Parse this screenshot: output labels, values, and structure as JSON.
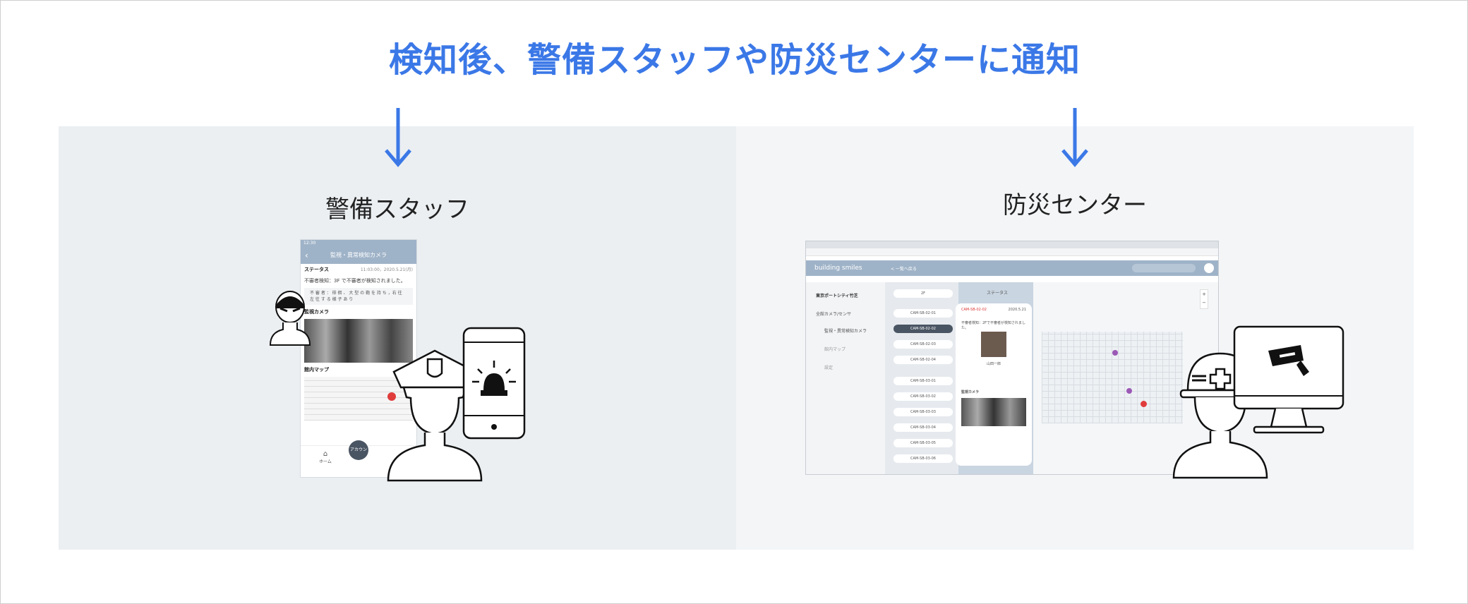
{
  "title": "検知後、警備スタッフや防災センターに通知",
  "colors": {
    "accent": "#3b78e7",
    "left_panel": "#ebeff2",
    "right_panel": "#f3f5f7",
    "app_header": "#9fb3c8"
  },
  "left": {
    "heading": "警備スタッフ",
    "phone": {
      "status_time": "12:30",
      "app_title": "監視・異常検知カメラ",
      "status_label": "ステータス",
      "status_time_detail": "11:03:00，2020.5.21(月)",
      "alert_text": "不審者検知：3F で不審者が検知されました。",
      "note_text": "不 審 者 ： 徘 徊 、 大 型 の 鞄 を 持 ち ，右 往 左 往 す る 様 子 あ り",
      "camera_label": "監視カメラ",
      "map_label": "館内マップ",
      "tab_home": "ホーム",
      "tab_center": "アカウント"
    }
  },
  "right": {
    "heading": "防災センター",
    "browser": {
      "brand": "building smiles",
      "nav_link": "< 一覧へ戻る",
      "sidebar": [
        "東京ポートシティ竹芝",
        "全館カメラ/センサ",
        "監視・異常検知カメラ",
        "館内マップ",
        "設定"
      ],
      "floor_select": "2F",
      "cameras_2f": [
        "CAM-SB-02-01",
        "CAM-SB-02-02",
        "CAM-SB-02-03",
        "CAM-SB-02-04"
      ],
      "cameras_3f": [
        "CAM-SB-03-01",
        "CAM-SB-03-02",
        "CAM-SB-03-03",
        "CAM-SB-03-04",
        "CAM-SB-03-05",
        "CAM-SB-03-06"
      ],
      "detail_title": "ステータス",
      "detail_cam": "CAM-SB-02-02",
      "detail_date": "2020.5.21",
      "detail_alert": "不審者検知：2Fで不審者が検知されました。",
      "detail_name": "山田一郎",
      "detail_camera_label": "監視カメラ"
    }
  }
}
